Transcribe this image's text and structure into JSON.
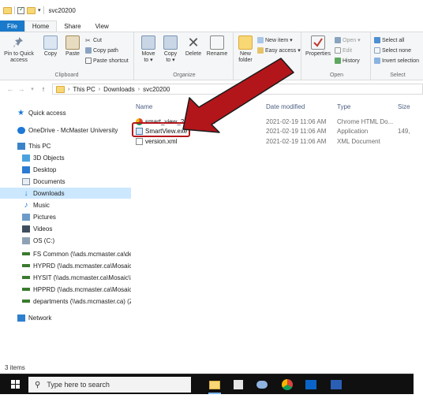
{
  "window": {
    "title": "svc20200"
  },
  "ribbon": {
    "tabs": [
      "File",
      "Home",
      "Share",
      "View"
    ],
    "clipboard": {
      "pin_label": "Pin to Quick access",
      "copy_label": "Copy",
      "paste_label": "Paste",
      "cut_label": "Cut",
      "copy_path_label": "Copy path",
      "paste_shortcut_label": "Paste shortcut",
      "group_label": "Clipboard"
    },
    "organize": {
      "move_to_label": "Move to ▾",
      "copy_to_label": "Copy to ▾",
      "delete_label": "Delete",
      "rename_label": "Rename",
      "group_label": "Organize"
    },
    "new": {
      "new_folder_label": "New folder",
      "new_item_label": "New item ▾",
      "easy_access_label": "Easy access ▾",
      "group_label": "New"
    },
    "open": {
      "properties_label": "Properties",
      "open_label": "Open ▾",
      "edit_label": "Edit",
      "history_label": "History",
      "group_label": "Open"
    },
    "select": {
      "select_all_label": "Select all",
      "select_none_label": "Select none",
      "invert_label": "Invert selection",
      "group_label": "Select"
    }
  },
  "address": {
    "segments": [
      "This PC",
      "Downloads",
      "svc20200"
    ]
  },
  "nav": {
    "items": [
      {
        "label": "Quick access",
        "icon": "star-icon"
      },
      {
        "label": "OneDrive - McMaster University",
        "icon": "cloud-icon"
      },
      {
        "label": "This PC",
        "icon": "computer-icon"
      },
      {
        "label": "3D Objects",
        "icon": "cube-icon"
      },
      {
        "label": "Desktop",
        "icon": "desktop-icon"
      },
      {
        "label": "Documents",
        "icon": "documents-icon"
      },
      {
        "label": "Downloads",
        "icon": "download-arrow-icon"
      },
      {
        "label": "Music",
        "icon": "music-note-icon"
      },
      {
        "label": "Pictures",
        "icon": "pictures-icon"
      },
      {
        "label": "Videos",
        "icon": "film-icon"
      },
      {
        "label": "OS (C:)",
        "icon": "drive-icon"
      },
      {
        "label": "FS Common (\\\\ads.mcmaster.ca\\de",
        "icon": "network-drive-icon"
      },
      {
        "label": "HYPRD (\\\\ads.mcmaster.ca\\Mosaic",
        "icon": "network-drive-icon"
      },
      {
        "label": "HYSIT (\\\\ads.mcmaster.ca\\Mosaic\\I",
        "icon": "network-drive-icon"
      },
      {
        "label": "HPPRD (\\\\ads.mcmaster.ca\\Mosaic",
        "icon": "network-drive-icon"
      },
      {
        "label": "departments (\\\\ads.mcmaster.ca) (Z",
        "icon": "network-drive-icon"
      },
      {
        "label": "Network",
        "icon": "network-icon"
      }
    ],
    "selected": "Downloads"
  },
  "files": {
    "columns": [
      "Name",
      "Date modified",
      "Type",
      "Size"
    ],
    "rows": [
      {
        "name": "smart_view_20200...html",
        "date": "2021-02-19 11:06 AM",
        "type": "Chrome HTML Do...",
        "size": "",
        "icon": "chrome-icon"
      },
      {
        "name": "SmartView.exe",
        "date": "2021-02-19 11:06 AM",
        "type": "Application",
        "size": "149,",
        "icon": "exe-icon"
      },
      {
        "name": "version.xml",
        "date": "2021-02-19 11:06 AM",
        "type": "XML Document",
        "size": "",
        "icon": "xml-file-icon"
      }
    ]
  },
  "status": {
    "item_count": "3 items"
  },
  "taskbar": {
    "search_placeholder": "Type here to search",
    "apps": [
      "file-explorer-icon",
      "store-icon",
      "paint-icon",
      "chrome-icon",
      "outlook-icon",
      "word-icon"
    ]
  },
  "colors": {
    "accent": "#1979ca",
    "arrow": "#b3161a",
    "selection": "#cce8ff",
    "taskbar": "#101010"
  }
}
